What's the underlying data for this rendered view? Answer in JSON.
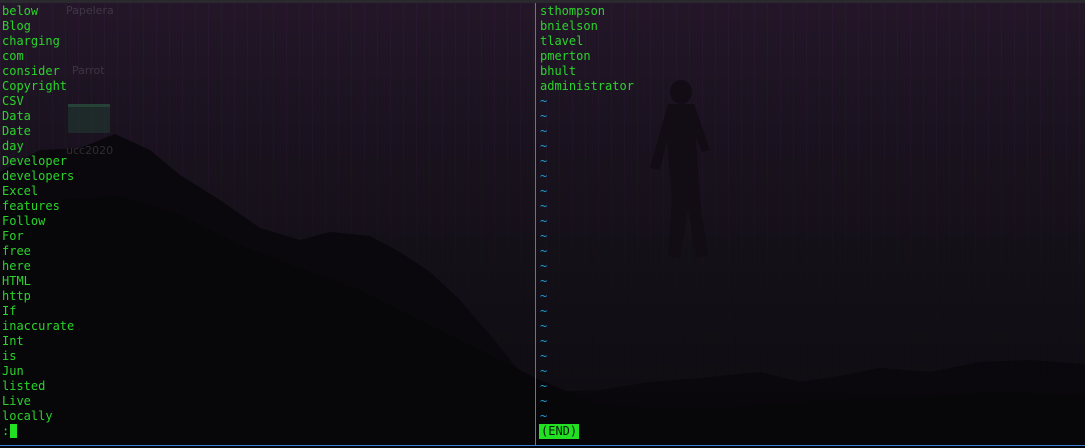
{
  "desktop": {
    "icons": [
      "Papelera",
      "Parrot",
      "ucc2020"
    ]
  },
  "left_pane": {
    "lines": [
      "below",
      "Blog",
      "charging",
      "com",
      "consider",
      "Copyright",
      "CSV",
      "Data",
      "Date",
      "day",
      "Developer",
      "developers",
      "Excel",
      "features",
      "Follow",
      "For",
      "free",
      "here",
      "HTML",
      "http",
      "If",
      "inaccurate",
      "Int",
      "is",
      "Jun",
      "listed",
      "Live",
      "locally"
    ],
    "prompt": ":"
  },
  "right_pane": {
    "lines": [
      "sthompson",
      "bnielson",
      "tlavel",
      "pmerton",
      "bhult",
      "administrator"
    ],
    "tilde": "~",
    "tilde_count": 22,
    "end_marker": "(END)"
  },
  "colors": {
    "text": "#2bd42b",
    "tilde": "#1c9bd4",
    "cursor": "#22e022",
    "divider": "#3a7fd8"
  }
}
